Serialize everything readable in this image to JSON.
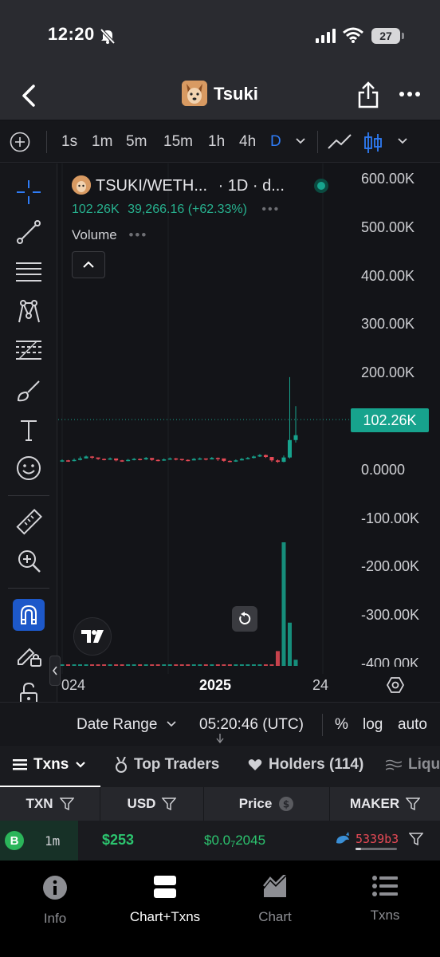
{
  "status_bar": {
    "time": "12:20",
    "battery": "27"
  },
  "header": {
    "title": "Tsuki"
  },
  "timeframes": [
    "1s",
    "1m",
    "5m",
    "15m",
    "1h",
    "4h",
    "D"
  ],
  "active_timeframe": "D",
  "legend": {
    "pair": "TSUKI/WETH...",
    "interval": "· 1D · d...",
    "last": "102.26K",
    "change": "39,266.16 (+62.33%)",
    "volume_label": "Volume"
  },
  "colors": {
    "up": "#17a38d",
    "down": "#e74a56",
    "accent": "#2f7cf6"
  },
  "chart_data": {
    "type": "candlestick",
    "y_ticks": [
      "600.00K",
      "500.00K",
      "400.00K",
      "300.00K",
      "200.00K",
      "100.00K",
      "0.0000",
      "-100.00K",
      "-200.00K",
      "-300.00K",
      "-400.00K"
    ],
    "y_range": [
      -400000,
      600000
    ],
    "x_ticks": [
      "024",
      "2025",
      "24"
    ],
    "last_price_label": "102.26K",
    "last_price": 102260,
    "close": [
      18000,
      17000,
      19000,
      22000,
      26000,
      24000,
      21000,
      20000,
      22000,
      18000,
      17000,
      19000,
      21000,
      20000,
      23000,
      19000,
      18000,
      20000,
      22000,
      21000,
      19000,
      18000,
      21000,
      22000,
      20000,
      23000,
      22000,
      17000,
      16000,
      18000,
      21000,
      23000,
      26000,
      29000,
      25000,
      18000,
      15000,
      24000,
      60000,
      70000
    ],
    "high": [
      20000,
      19000,
      22000,
      26000,
      28000,
      27000,
      23000,
      22000,
      24000,
      21000,
      19000,
      21000,
      23000,
      22000,
      25000,
      22000,
      20000,
      22000,
      24000,
      23000,
      21000,
      20000,
      23000,
      24000,
      22000,
      25000,
      24000,
      21000,
      18000,
      20000,
      23000,
      25000,
      28000,
      31000,
      30000,
      24000,
      20000,
      28000,
      190000,
      130000
    ],
    "low": [
      15000,
      15000,
      16000,
      18000,
      22000,
      21000,
      19000,
      18000,
      19000,
      16000,
      15000,
      16000,
      18000,
      18000,
      19000,
      17000,
      16000,
      17000,
      19000,
      18000,
      17000,
      16000,
      18000,
      19000,
      18000,
      20000,
      17000,
      15000,
      14000,
      15000,
      18000,
      20000,
      22000,
      25000,
      23000,
      15000,
      13000,
      14000,
      22000,
      55000
    ],
    "open": [
      17000,
      18000,
      17000,
      19000,
      22000,
      26000,
      24000,
      21000,
      20000,
      22000,
      18000,
      17000,
      19000,
      21000,
      20000,
      23000,
      19000,
      18000,
      20000,
      22000,
      21000,
      19000,
      18000,
      21000,
      22000,
      20000,
      23000,
      22000,
      17000,
      16000,
      18000,
      21000,
      23000,
      26000,
      29000,
      25000,
      18000,
      15000,
      24000,
      60000
    ],
    "volume_relative": [
      0.01,
      0.01,
      0.01,
      0.01,
      0.01,
      0.01,
      0.01,
      0.01,
      0.01,
      0.01,
      0.01,
      0.01,
      0.01,
      0.01,
      0.01,
      0.01,
      0.01,
      0.01,
      0.01,
      0.01,
      0.01,
      0.01,
      0.01,
      0.01,
      0.01,
      0.01,
      0.01,
      0.01,
      0.01,
      0.01,
      0.01,
      0.01,
      0.01,
      0.01,
      0.01,
      0.01,
      0.12,
      1.0,
      0.35,
      0.05
    ]
  },
  "range_bar": {
    "date_range": "Date Range",
    "clock": "05:20:46 (UTC)",
    "percent": "%",
    "log": "log",
    "auto": "auto"
  },
  "tabs": [
    {
      "label": "Txns"
    },
    {
      "label": "Top Traders"
    },
    {
      "label": "Holders (114)"
    },
    {
      "label": "Liqu"
    }
  ],
  "table_headers": [
    "TXN",
    "USD",
    "Price",
    "MAKER"
  ],
  "rows": [
    {
      "type": "B",
      "age": "1m",
      "usd": "$253",
      "price_main": "$0.0",
      "price_sub": "7",
      "price_tail": "2045",
      "maker": "5339b3",
      "maker_share": 0.14
    }
  ],
  "bottom_nav": [
    {
      "label": "Info"
    },
    {
      "label": "Chart+Txns"
    },
    {
      "label": "Chart"
    },
    {
      "label": "Txns"
    }
  ]
}
